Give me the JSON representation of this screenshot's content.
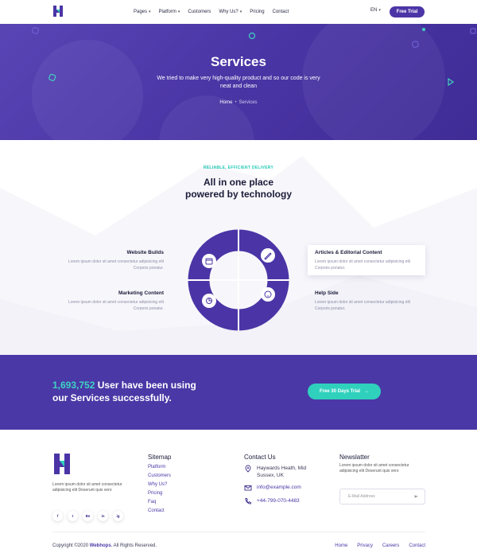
{
  "header": {
    "nav": [
      {
        "label": "Pages",
        "has_caret": true
      },
      {
        "label": "Platform",
        "has_caret": true
      },
      {
        "label": "Customers",
        "has_caret": false
      },
      {
        "label": "Why Us?",
        "has_caret": true
      },
      {
        "label": "Pricing",
        "has_caret": false
      },
      {
        "label": "Contact",
        "has_caret": false
      }
    ],
    "lang": "EN",
    "trial_label": "Free Trial"
  },
  "hero": {
    "title": "Services",
    "subtitle": "We tried to make very high-quality product and so our code is very neat and clean",
    "breadcrumb_home": "Home",
    "breadcrumb_current": "Services"
  },
  "services": {
    "kicker": "RELIABLE, EFFICIENT DELIVERY",
    "title_line1": "All in one place",
    "title_line2": "powered by technology",
    "items": [
      {
        "title": "Website Builds",
        "text": "Lorem ipsum dolor sit amet consectetur adipisicing elit Corporis ponatur."
      },
      {
        "title": "Marketing Content",
        "text": "Lorem ipsum dolor sit amet consectetur adipisicing elit Corporis ponatur."
      },
      {
        "title": "Articles & Editorial Content",
        "text": "Lorem ipsum dolor sit amet consectetur adipisicing elit Corporis ponatur."
      },
      {
        "title": "Help Side",
        "text": "Lorem ipsum dolor sit amet consectetur adipisicing elit Corporis ponatur."
      }
    ]
  },
  "band": {
    "number": "1,693,752",
    "text_line1": " User have been using",
    "text_line2": "our Services successfully.",
    "button": "Free 30 Days Trial"
  },
  "footer": {
    "about": "Lorem ipsum dolor sit amet consectetur adipisicing elit Deserunt quis vero",
    "socials": [
      "f",
      "t",
      "Be",
      "in",
      "ig"
    ],
    "sitemap_title": "Sitemap",
    "sitemap": [
      "Platform",
      "Customers",
      "Why Us?",
      "Pricing",
      "Faq",
      "Contact"
    ],
    "contact_title": "Contact Us",
    "address_line1": "Haywards Heath, Mid",
    "address_line2": "Sussex, UK",
    "email": "info@example.com",
    "phone": "+44-799-070-4483",
    "newsletter_title": "Newslatter",
    "newsletter_text": "Lorem ipsum dolor sit amet consectetur adipisicing elit Deserunt quis vero",
    "email_placeholder": "E-Mail Address",
    "copyright_prefix": "Copyright ©2020 ",
    "copyright_brand": "Webhops",
    "copyright_suffix": ". All Rights Reserved.",
    "bottom_links": [
      "Home",
      "Privacy",
      "Careers",
      "Contact"
    ]
  },
  "colors": {
    "primary": "#4a38a6",
    "accent": "#2fd1bd"
  }
}
